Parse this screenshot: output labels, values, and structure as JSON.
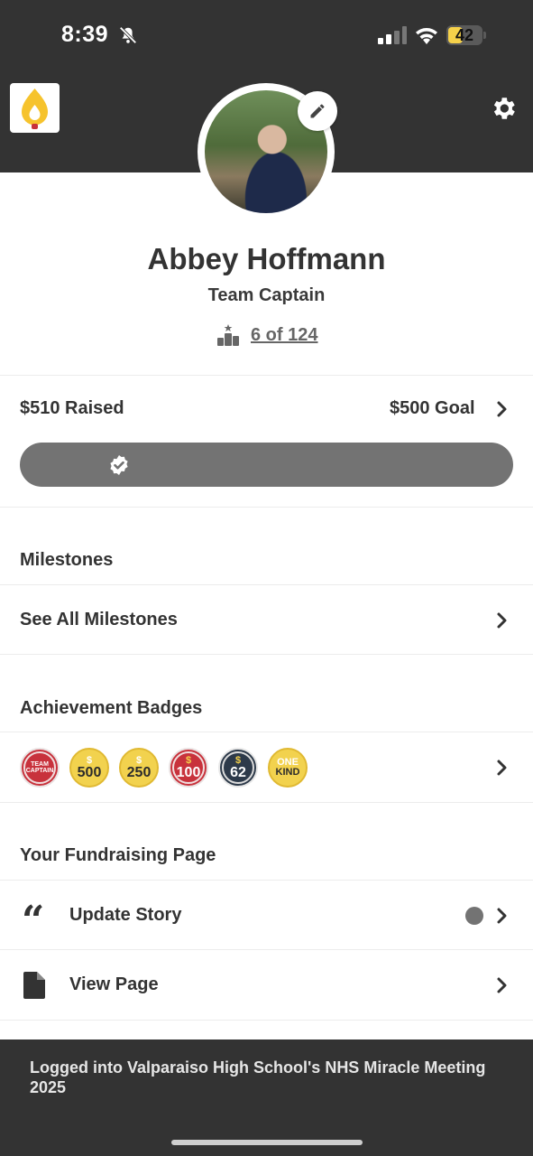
{
  "status_bar": {
    "time": "8:39",
    "battery": "42"
  },
  "header": {
    "logo_icon": "candle-flame-icon",
    "settings_icon": "gear-icon"
  },
  "profile": {
    "name": "Abbey Hoffmann",
    "role": "Team Captain",
    "rank": "6 of 124"
  },
  "fundraising": {
    "raised_label": "$510 Raised",
    "goal_label": "$500 Goal",
    "progress_fraction": 1.0
  },
  "sections": {
    "milestones": {
      "title": "Milestones",
      "see_all": "See All Milestones"
    },
    "badges": {
      "title": "Achievement Badges",
      "items": [
        {
          "top": "TEAM",
          "bottom": "CAPTAIN",
          "style": "red"
        },
        {
          "top": "$",
          "bottom": "500",
          "style": "gold"
        },
        {
          "top": "$",
          "bottom": "250",
          "style": "gold"
        },
        {
          "top": "$",
          "bottom": "100",
          "style": "red"
        },
        {
          "top": "$",
          "bottom": "62",
          "style": "navy"
        },
        {
          "top": "ONE",
          "bottom": "KIND",
          "style": "gold"
        }
      ]
    },
    "fundraising_page": {
      "title": "Your Fundraising Page",
      "update_story": "Update Story",
      "view_page": "View Page"
    }
  },
  "footer": {
    "text": "Logged into Valparaiso High School's NHS Miracle Meeting 2025"
  },
  "colors": {
    "header_bg": "#333333",
    "progress_bar": "#737373",
    "badge_red": "#c8323c",
    "badge_gold": "#f2d24e",
    "badge_navy": "#2d3a4a"
  }
}
